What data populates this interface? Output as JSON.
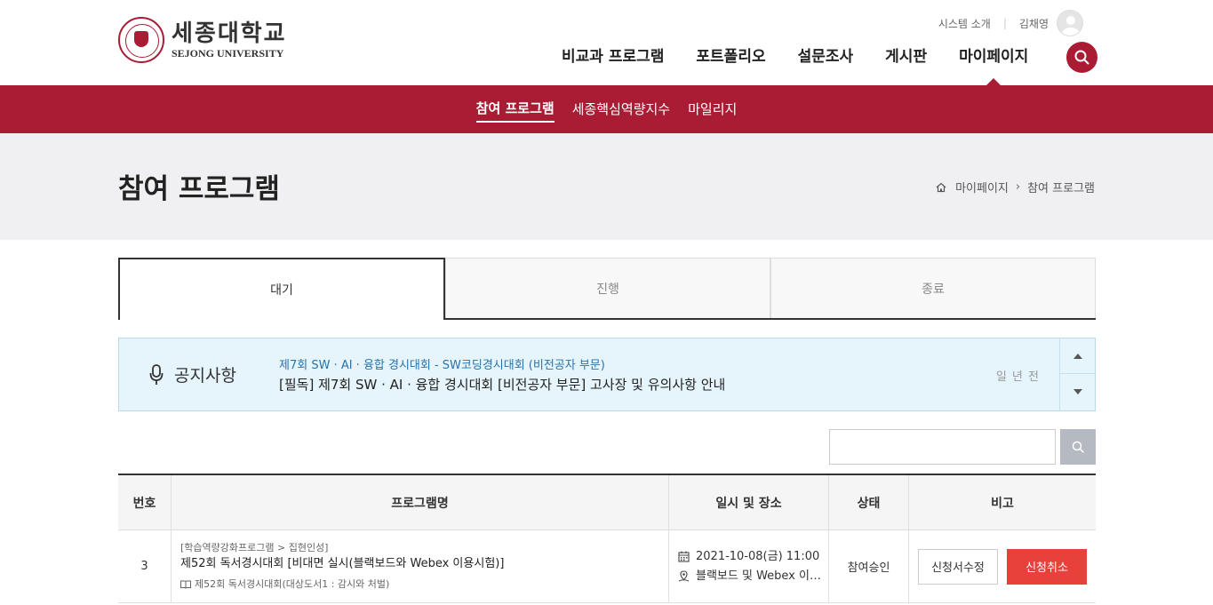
{
  "header": {
    "logo_ko": "세종대학교",
    "logo_en": "SEJONG UNIVERSITY",
    "util_system": "시스템 소개",
    "user_name": "김채영",
    "nav": [
      "비교과 프로그램",
      "포트폴리오",
      "설문조사",
      "게시판",
      "마이페이지"
    ],
    "active_nav": "마이페이지"
  },
  "subnav": [
    "참여 프로그램",
    "세종핵심역량지수",
    "마일리지"
  ],
  "page": {
    "title": "참여 프로그램",
    "breadcrumb": [
      "마이페이지",
      "참여 프로그램"
    ]
  },
  "tabs": [
    "대기",
    "진행",
    "종료"
  ],
  "notice": {
    "label": "공지사항",
    "sub": "제7회 SW · AI · 융합 경시대회 - SW코딩경시대회 (비전공자 부문)",
    "main": "[필독] 제7회 SW · AI · 융합 경시대회 [비전공자 부문] 고사장 및 유의사항 안내",
    "time": "일 년 전"
  },
  "search": {
    "value": ""
  },
  "table": {
    "headers": [
      "번호",
      "프로그램명",
      "일시 및 장소",
      "상태",
      "비고"
    ],
    "rows": [
      {
        "no": "3",
        "category": "[학습역량강화프로그램 > 집현인성]",
        "title": "제52회 독서경시대회 [비대면 실시(블랙보드와 Webex 이용시험)]",
        "book": "제52회 독서경시대회(대상도서1 : 감시와 처벌)",
        "date": "2021-10-08(금) 11:00",
        "place": "블랙보드 및 Webex 이…",
        "status": "참여승인",
        "edit_label": "신청서수정",
        "cancel_label": "신청취소"
      }
    ]
  },
  "colors": {
    "brand": "#a91c34",
    "cancel": "#e8403a",
    "notice_bg": "#e6f4fc"
  }
}
